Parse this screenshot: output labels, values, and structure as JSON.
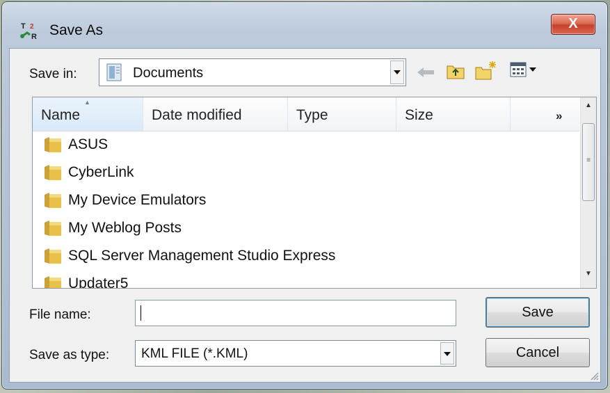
{
  "window": {
    "title": "Save As",
    "close_label": "X",
    "app_icon": "t2r-app-icon"
  },
  "save_in": {
    "label": "Save in:",
    "value": "Documents",
    "icon": "documents-library-icon"
  },
  "toolbar": {
    "back_icon": "back-arrow-icon",
    "up_icon": "up-folder-icon",
    "new_folder_icon": "new-folder-icon",
    "views_icon": "views-menu-icon"
  },
  "columns": [
    {
      "label": "Name"
    },
    {
      "label": "Date modified"
    },
    {
      "label": "Type"
    },
    {
      "label": "Size"
    }
  ],
  "more_columns": "»",
  "files": [
    {
      "name": "ASUS"
    },
    {
      "name": "CyberLink"
    },
    {
      "name": "My Device Emulators"
    },
    {
      "name": "My Weblog Posts"
    },
    {
      "name": "SQL Server Management Studio Express"
    },
    {
      "name": "Updater5"
    }
  ],
  "file_name": {
    "label": "File name:",
    "value": ""
  },
  "save_as_type": {
    "label": "Save as type:",
    "value": "KML FILE (*.KML)"
  },
  "buttons": {
    "save": "Save",
    "cancel": "Cancel"
  },
  "colors": {
    "close_red": "#c5402b",
    "frame_blue": "#a9bbcf",
    "folder_yellow": "#e8c14a"
  }
}
